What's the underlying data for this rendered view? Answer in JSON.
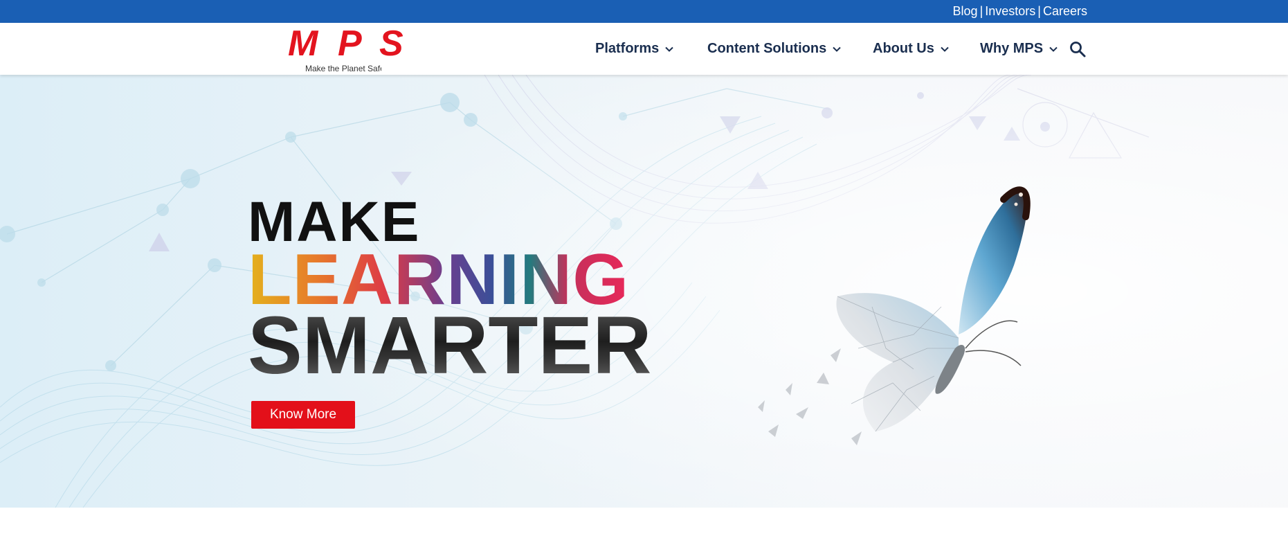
{
  "topbar": {
    "links": [
      {
        "label": "Blog"
      },
      {
        "label": "Investors"
      },
      {
        "label": "Careers"
      }
    ],
    "separator": "|",
    "background_color": "#1a5fb4"
  },
  "logo": {
    "letters": [
      "M",
      "P",
      "S"
    ],
    "tagline": "Make the Planet Safe",
    "color": "#e3141f"
  },
  "nav": {
    "items": [
      {
        "label": "Platforms",
        "icon": "chevron-down-icon"
      },
      {
        "label": "Content Solutions",
        "icon": "chevron-down-icon"
      },
      {
        "label": "About Us",
        "icon": "chevron-down-icon"
      },
      {
        "label": "Why MPS",
        "icon": "chevron-down-icon"
      }
    ],
    "search_icon": "search-icon",
    "text_color": "#1a2e4f"
  },
  "hero": {
    "line1": "MAKE",
    "line2": "LEARNING",
    "line3": "SMARTER",
    "cta_label": "Know More",
    "cta_color": "#e3101a",
    "illustration": "butterfly-icon"
  }
}
